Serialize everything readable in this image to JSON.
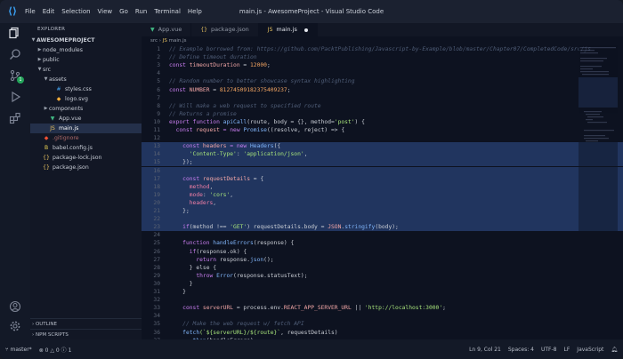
{
  "window": {
    "title": "main.js - AwesomeProject - Visual Studio Code",
    "menu": [
      "File",
      "Edit",
      "Selection",
      "View",
      "Go",
      "Run",
      "Terminal",
      "Help"
    ]
  },
  "sidebar": {
    "title": "EXPLORER",
    "project": "AWESOMEPROJECT",
    "tree": [
      {
        "label": "node_modules",
        "depth": 1,
        "kind": "folder",
        "open": false
      },
      {
        "label": "public",
        "depth": 1,
        "kind": "folder",
        "open": false
      },
      {
        "label": "src",
        "depth": 1,
        "kind": "folder",
        "open": true
      },
      {
        "label": "assets",
        "depth": 2,
        "kind": "folder",
        "open": true
      },
      {
        "label": "styles.css",
        "depth": 3,
        "kind": "css"
      },
      {
        "label": "logo.svg",
        "depth": 3,
        "kind": "svg"
      },
      {
        "label": "components",
        "depth": 2,
        "kind": "folder",
        "open": false
      },
      {
        "label": "App.vue",
        "depth": 2,
        "kind": "vue"
      },
      {
        "label": "main.js",
        "depth": 2,
        "kind": "js",
        "selected": true
      },
      {
        "label": ".gitignore",
        "depth": 1,
        "kind": "git"
      },
      {
        "label": "babel.config.js",
        "depth": 1,
        "kind": "babel"
      },
      {
        "label": "package-lock.json",
        "depth": 1,
        "kind": "json"
      },
      {
        "label": "package.json",
        "depth": 1,
        "kind": "json"
      }
    ],
    "outline_label": "OUTLINE",
    "npm_label": "NPM SCRIPTS"
  },
  "tabs": [
    {
      "label": "App.vue",
      "icon": "vue-icon",
      "active": false
    },
    {
      "label": "package.json",
      "icon": "json-icon",
      "active": false
    },
    {
      "label": "main.js",
      "icon": "js-icon",
      "active": true,
      "modified": true
    }
  ],
  "breadcrumb": [
    "src",
    "main.js"
  ],
  "code_lines": [
    {
      "n": "1",
      "t": [
        [
          "// Example borrowed from: https://github.com/PacktPublishing/Javascript-by-Example/blob/master/Chapter07/CompletedCode/src/js",
          "c"
        ]
      ]
    },
    {
      "n": "2",
      "t": [
        [
          "// Define timeout duration",
          "c"
        ]
      ]
    },
    {
      "n": "3",
      "t": [
        [
          "const ",
          "k"
        ],
        [
          "timeoutDuration",
          "v"
        ],
        [
          " = ",
          "p"
        ],
        [
          "12000",
          "n"
        ],
        [
          ";",
          "p"
        ]
      ]
    },
    {
      "n": "4",
      "t": []
    },
    {
      "n": "5",
      "t": [
        [
          "// Random number to better showcase syntax highlighting",
          "c"
        ]
      ]
    },
    {
      "n": "6",
      "t": [
        [
          "const ",
          "k"
        ],
        [
          "NUMBER",
          "v"
        ],
        [
          " = ",
          "p"
        ],
        [
          "81274509182375409237",
          "n"
        ],
        [
          ";",
          "p"
        ]
      ]
    },
    {
      "n": "7",
      "t": []
    },
    {
      "n": "8",
      "t": [
        [
          "// Will make a web request to specified route",
          "c"
        ]
      ]
    },
    {
      "n": "9",
      "t": [
        [
          "// Returns a promise",
          "c"
        ]
      ]
    },
    {
      "n": "10",
      "t": [
        [
          "export function ",
          "k"
        ],
        [
          "apiCall",
          "f"
        ],
        [
          "(route, body = {}, method=",
          "p"
        ],
        [
          "'post'",
          "s"
        ],
        [
          ") {",
          "p"
        ]
      ]
    },
    {
      "n": "11",
      "t": [
        [
          "  const ",
          "k"
        ],
        [
          "request",
          "v"
        ],
        [
          " = new ",
          "k"
        ],
        [
          "Promise",
          "f"
        ],
        [
          "((resolve, reject) => {",
          "p"
        ]
      ]
    },
    {
      "n": "12",
      "t": []
    },
    {
      "n": "13",
      "hl": true,
      "t": [
        [
          "    const ",
          "k"
        ],
        [
          "headers",
          "v"
        ],
        [
          " = new ",
          "k"
        ],
        [
          "Headers",
          "f"
        ],
        [
          "({",
          "p"
        ]
      ]
    },
    {
      "n": "14",
      "hl": true,
      "t": [
        [
          "      'Content-Type'",
          "s"
        ],
        [
          ": ",
          "p"
        ],
        [
          "'application/json'",
          "s"
        ],
        [
          ",",
          "p"
        ]
      ]
    },
    {
      "n": "15",
      "hl": true,
      "t": [
        [
          "    });",
          "p"
        ]
      ]
    },
    {
      "n": "16",
      "hl": true,
      "t": []
    },
    {
      "n": "17",
      "hl": true,
      "t": [
        [
          "    const ",
          "k"
        ],
        [
          "requestDetails",
          "v"
        ],
        [
          " = {",
          "p"
        ]
      ]
    },
    {
      "n": "18",
      "hl": true,
      "t": [
        [
          "      method",
          "a"
        ],
        [
          ",",
          "p"
        ]
      ]
    },
    {
      "n": "19",
      "hl": true,
      "t": [
        [
          "      mode",
          "a"
        ],
        [
          ": ",
          "p"
        ],
        [
          "'cors'",
          "s"
        ],
        [
          ",",
          "p"
        ]
      ]
    },
    {
      "n": "20",
      "hl": true,
      "t": [
        [
          "      headers",
          "a"
        ],
        [
          ",",
          "p"
        ]
      ]
    },
    {
      "n": "21",
      "hl": true,
      "t": [
        [
          "    };",
          "p"
        ]
      ]
    },
    {
      "n": "22",
      "hl": true,
      "t": []
    },
    {
      "n": "23",
      "hl": true,
      "t": [
        [
          "    if",
          "k"
        ],
        [
          "(method !== ",
          "p"
        ],
        [
          "'GET'",
          "s"
        ],
        [
          ") requestDetails.body = ",
          "p"
        ],
        [
          "JSON",
          "v"
        ],
        [
          ".",
          "p"
        ],
        [
          "stringify",
          "f"
        ],
        [
          "(body);",
          "p"
        ]
      ]
    },
    {
      "n": "24",
      "t": []
    },
    {
      "n": "25",
      "t": [
        [
          "    function ",
          "k"
        ],
        [
          "handleErrors",
          "f"
        ],
        [
          "(response) {",
          "p"
        ]
      ]
    },
    {
      "n": "26",
      "t": [
        [
          "      if",
          "k"
        ],
        [
          "(response.ok) {",
          "p"
        ]
      ]
    },
    {
      "n": "27",
      "t": [
        [
          "        return ",
          "k"
        ],
        [
          "response.",
          "p"
        ],
        [
          "json",
          "f"
        ],
        [
          "();",
          "p"
        ]
      ]
    },
    {
      "n": "28",
      "t": [
        [
          "      } else {",
          "p"
        ]
      ]
    },
    {
      "n": "29",
      "t": [
        [
          "        throw ",
          "k"
        ],
        [
          "Error",
          "f"
        ],
        [
          "(response.statusText);",
          "p"
        ]
      ]
    },
    {
      "n": "30",
      "t": [
        [
          "      }",
          "p"
        ]
      ]
    },
    {
      "n": "31",
      "t": [
        [
          "    }",
          "p"
        ]
      ]
    },
    {
      "n": "32",
      "t": []
    },
    {
      "n": "33",
      "t": [
        [
          "    const ",
          "k"
        ],
        [
          "serverURL",
          "v"
        ],
        [
          " = process.env.",
          "p"
        ],
        [
          "REACT_APP_SERVER_URL",
          "v"
        ],
        [
          " || ",
          "p"
        ],
        [
          "'http://localhost:3000'",
          "s"
        ],
        [
          ";",
          "p"
        ]
      ]
    },
    {
      "n": "34",
      "t": []
    },
    {
      "n": "35",
      "t": [
        [
          "    // Make the web request w/ fetch API",
          "c"
        ]
      ]
    },
    {
      "n": "36",
      "t": [
        [
          "    fetch",
          "f"
        ],
        [
          "(`${serverURL}/${route}`",
          "s"
        ],
        [
          ", requestDetails)",
          "p"
        ]
      ]
    },
    {
      "n": "37",
      "t": [
        [
          "      .",
          "p"
        ],
        [
          "then",
          "f"
        ],
        [
          "(handleErrors)",
          "p"
        ]
      ]
    }
  ],
  "token_colors": {
    "c": "#4f5d77",
    "k": "#c97ef0",
    "v": "#f0a5a5",
    "f": "#7fb3f7",
    "s": "#a6e27a",
    "n": "#f5a662",
    "p": "#c8ccd4",
    "a": "#f07ea6"
  },
  "statusbar": {
    "branch": "master*",
    "errors": "0",
    "warnings": "0",
    "info": "1",
    "position": "Ln 9, Col 21",
    "spaces": "Spaces: 4",
    "encoding": "UTF-8",
    "eol": "LF",
    "language": "JavaScript"
  }
}
